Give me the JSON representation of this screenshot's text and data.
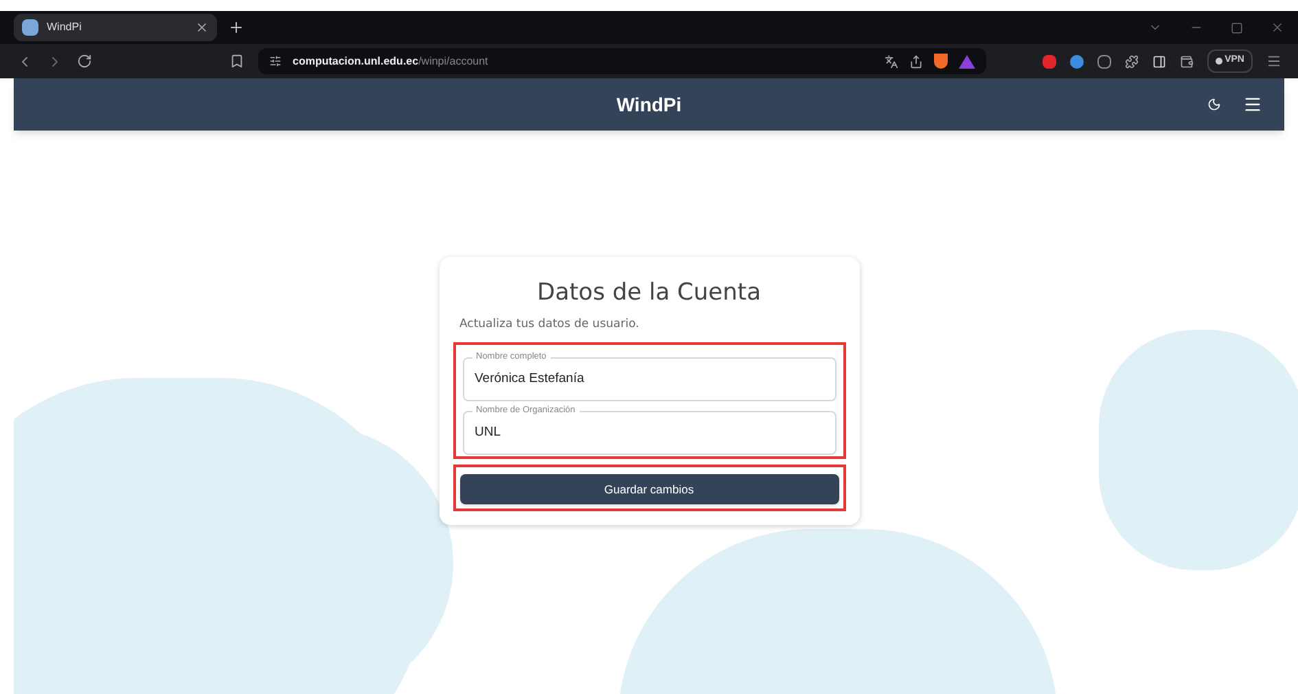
{
  "browser": {
    "tab": {
      "title": "WindPi",
      "selected": true
    },
    "url": {
      "domain": "computacion.unl.edu.ec",
      "path": "/winpi/account"
    },
    "vpn_label": "VPN"
  },
  "navbar": {
    "title": "WindPi"
  },
  "card": {
    "title": "Datos de la Cuenta",
    "subtitle": "Actualiza tus datos de usuario.",
    "fields": [
      {
        "label": "Nombre completo",
        "value": "Verónica Estefanía"
      },
      {
        "label": "Nombre de Organización",
        "value": "UNL"
      }
    ],
    "button": "Guardar cambios"
  }
}
